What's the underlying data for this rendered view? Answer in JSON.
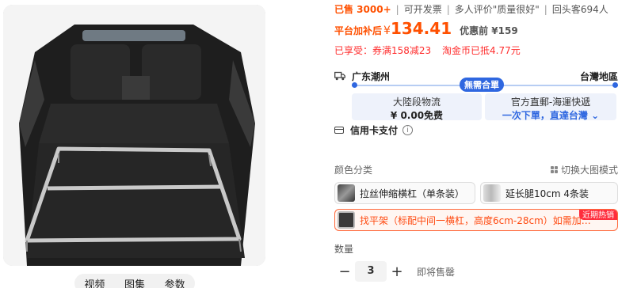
{
  "media_tabs": [
    "视频",
    "图集",
    "参数"
  ],
  "sales": {
    "sold": "已售 3000+",
    "invoice": "可开发票",
    "reviews": "多人评价\"质量很好\"",
    "repeat": "回头客694人"
  },
  "price": {
    "label": "平台加补后",
    "currency": "¥",
    "value": "134.41",
    "original": "优惠前 ¥159"
  },
  "promos": [
    "已享受：券满158减23",
    "淘金币已抵4.77元"
  ],
  "shipping": {
    "from": "广东潮州",
    "to": "台灣地區",
    "badge": "無需合單",
    "option1": {
      "title": "大陸段物流",
      "value": "¥ 0.00免费"
    },
    "option2": {
      "title": "官方直郵-海運快遞",
      "value": "一次下單，直達台灣"
    }
  },
  "credit": {
    "label": "信用卡支付",
    "info_icon": "i"
  },
  "color_section": {
    "title": "颜色分类",
    "switch_label": "切换大图模式"
  },
  "skus": [
    {
      "label": "拉丝伸缩横杠（单条装）"
    },
    {
      "label": "延长腿10cm 4条装"
    },
    {
      "label": "找平架（标配中间一横杠，高度6cm-28cm）如需加…",
      "badge": "近期热销"
    }
  ],
  "quantity": {
    "label": "数量",
    "value": "3",
    "minus": "−",
    "plus": "+",
    "stock": "即将售罄"
  },
  "colors": {
    "accent": "#ff5000",
    "blue": "#2f67e0",
    "promo_red": "#ff2e2e"
  }
}
